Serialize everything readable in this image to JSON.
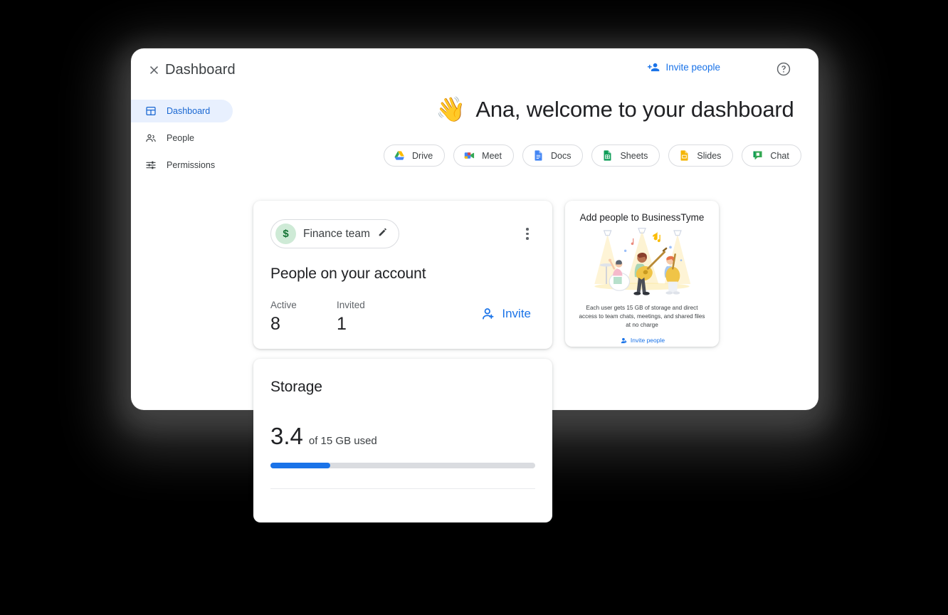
{
  "header": {
    "close_icon": "close-icon",
    "title": "Dashboard",
    "invite_people_label": "Invite people",
    "invite_icon": "person-add-icon",
    "help_icon": "help-circle-icon"
  },
  "sidebar": {
    "items": [
      {
        "label": "Dashboard",
        "icon": "dashboard-icon",
        "active": true
      },
      {
        "label": "People",
        "icon": "people-icon",
        "active": false
      },
      {
        "label": "Permissions",
        "icon": "tune-icon",
        "active": false
      }
    ]
  },
  "main": {
    "welcome_emoji": "👋",
    "welcome_text": "Ana, welcome to your dashboard",
    "app_chips": [
      {
        "label": "Drive",
        "icon": "drive-icon"
      },
      {
        "label": "Meet",
        "icon": "meet-icon"
      },
      {
        "label": "Docs",
        "icon": "docs-icon"
      },
      {
        "label": "Sheets",
        "icon": "sheets-icon"
      },
      {
        "label": "Slides",
        "icon": "slides-icon"
      },
      {
        "label": "Chat",
        "icon": "chat-icon"
      }
    ]
  },
  "people_card": {
    "team_avatar_text": "$",
    "team_name": "Finance team",
    "edit_icon": "pencil-icon",
    "menu_icon": "more-vert-icon",
    "heading": "People on your account",
    "stats": [
      {
        "label": "Active",
        "value": "8"
      },
      {
        "label": "Invited",
        "value": "1"
      }
    ],
    "invite_label": "Invite",
    "invite_icon": "person-add-icon"
  },
  "promo_card": {
    "title": "Add people to BusinessTyme",
    "illustration": "band-playing-music-illustration",
    "description": "Each user gets 15 GB of storage and direct access to team chats, meetings, and shared files at no charge",
    "link_label": "Invite people",
    "link_icon": "person-add-icon"
  },
  "storage_card": {
    "title": "Storage",
    "used_value": "3.4",
    "used_suffix": "of 15 GB used",
    "progress_percent": 22.7,
    "progress_fill_color": "#1a73e8",
    "progress_track_color": "#dadce0"
  },
  "colors": {
    "accent_blue": "#1a73e8",
    "active_nav_bg": "#e8f0fe",
    "active_nav_text": "#1967d2",
    "text_primary": "#202124",
    "text_secondary": "#5f6368",
    "green_avatar_bg": "#ceead6",
    "green_avatar_text": "#137333",
    "background": "#000000"
  }
}
